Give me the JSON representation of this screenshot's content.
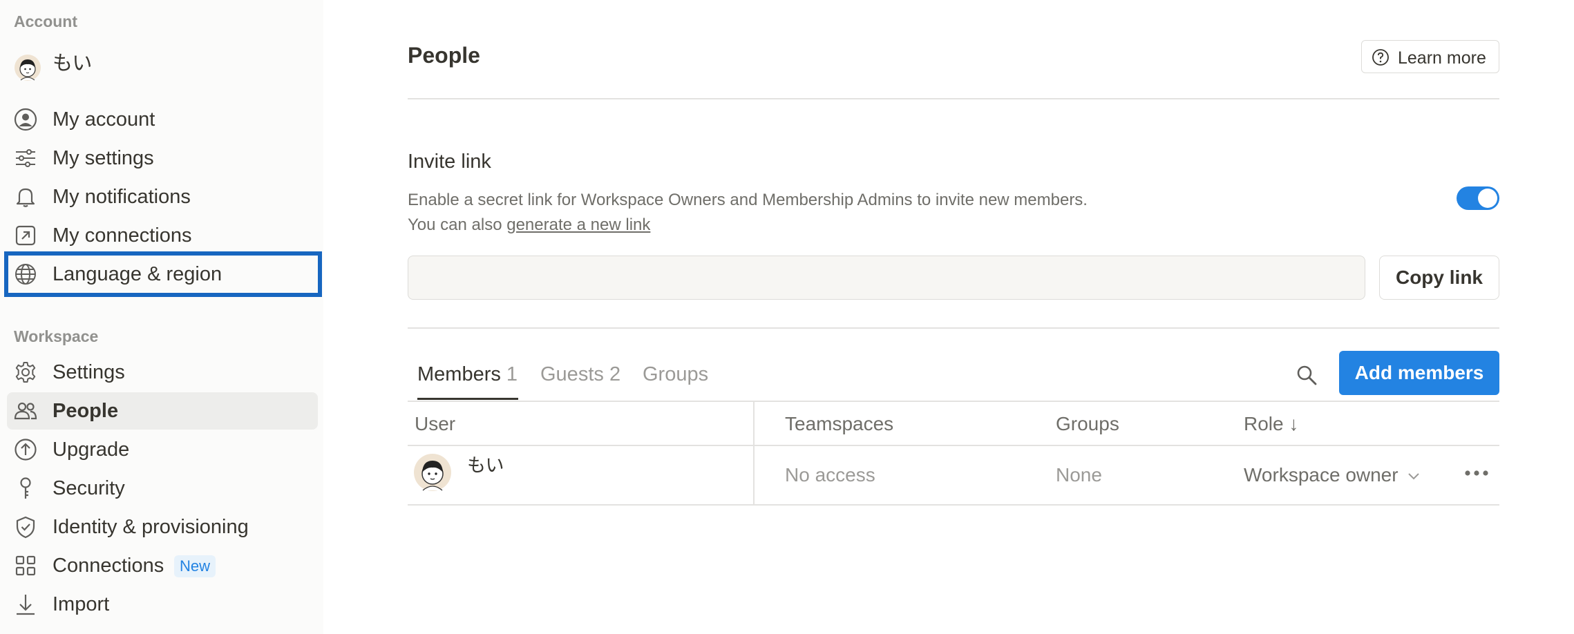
{
  "sidebar": {
    "account_label": "Account",
    "user_name": "もい",
    "account_items": [
      {
        "label": "My account",
        "icon": "user-circle-icon"
      },
      {
        "label": "My settings",
        "icon": "sliders-icon"
      },
      {
        "label": "My notifications",
        "icon": "bell-icon"
      },
      {
        "label": "My connections",
        "icon": "arrow-up-right-box-icon"
      },
      {
        "label": "Language & region",
        "icon": "globe-icon"
      }
    ],
    "workspace_label": "Workspace",
    "workspace_items": [
      {
        "label": "Settings",
        "icon": "gear-icon"
      },
      {
        "label": "People",
        "icon": "people-icon"
      },
      {
        "label": "Upgrade",
        "icon": "arrow-up-circle-icon"
      },
      {
        "label": "Security",
        "icon": "key-icon"
      },
      {
        "label": "Identity & provisioning",
        "icon": "shield-check-icon"
      },
      {
        "label": "Connections",
        "icon": "grid-icon",
        "badge": "New"
      },
      {
        "label": "Import",
        "icon": "import-arrow-icon"
      }
    ],
    "active_item": "People",
    "highlighted_item": "Language & region"
  },
  "main": {
    "title": "People",
    "learn_more": "Learn more",
    "invite": {
      "title": "Invite link",
      "desc_line1": "Enable a secret link for Workspace Owners and Membership Admins to invite new members.",
      "desc_prefix": "You can also ",
      "desc_link": "generate a new link",
      "enabled": true,
      "link_value": "",
      "copy_label": "Copy link"
    },
    "tabs": [
      {
        "label": "Members",
        "count": "1"
      },
      {
        "label": "Guests",
        "count": "2"
      },
      {
        "label": "Groups",
        "count": ""
      }
    ],
    "add_members": "Add members",
    "table": {
      "headers": [
        "User",
        "Teamspaces",
        "Groups",
        "Role ↓"
      ],
      "rows": [
        {
          "user": "もい",
          "teamspaces": "No access",
          "groups": "None",
          "role": "Workspace owner"
        }
      ]
    }
  },
  "colors": {
    "accent": "#2383e2",
    "highlight_box": "#1766c0",
    "sidebar_bg": "#fbfbfa"
  }
}
